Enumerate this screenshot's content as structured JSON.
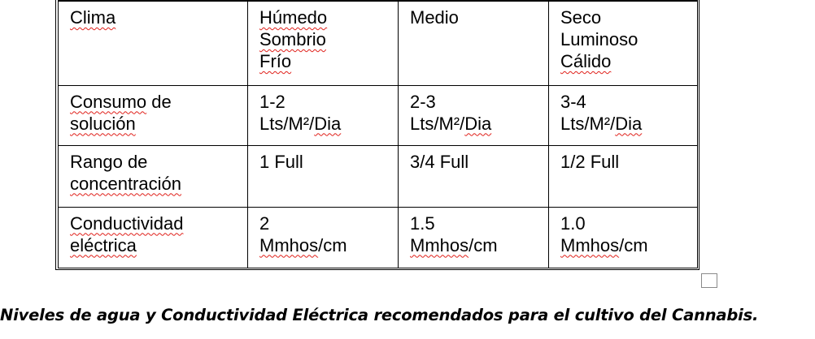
{
  "table": {
    "rows": [
      {
        "cells": [
          {
            "lines": [
              {
                "text": "Clima",
                "spell": true
              }
            ]
          },
          {
            "lines": [
              {
                "text": "Húmedo",
                "spell": true
              },
              {
                "text": "Sombrio",
                "spell": true
              },
              {
                "text": "Frío",
                "spell": true
              }
            ]
          },
          {
            "lines": [
              {
                "text": "Medio",
                "spell": false
              }
            ]
          },
          {
            "lines": [
              {
                "text": "Seco",
                "spell": false
              },
              {
                "text": "Luminoso",
                "spell": false
              },
              {
                "text": "Cálido",
                "spell": true
              }
            ]
          }
        ]
      },
      {
        "cells": [
          {
            "lines": [
              {
                "text": "Consumo de",
                "spell": "Consumo"
              },
              {
                "text": "solución",
                "spell": true
              }
            ]
          },
          {
            "lines": [
              {
                "text": "1-2",
                "spell": false
              },
              {
                "text": "Lts/M²/Dia",
                "spell": "Dia"
              }
            ]
          },
          {
            "lines": [
              {
                "text": "2-3",
                "spell": false
              },
              {
                "text": "Lts/M²/Dia",
                "spell": "Dia"
              }
            ]
          },
          {
            "lines": [
              {
                "text": "3-4",
                "spell": false
              },
              {
                "text": "Lts/M²/Dia",
                "spell": "Dia"
              }
            ]
          }
        ]
      },
      {
        "cells": [
          {
            "lines": [
              {
                "text": "Rango de",
                "spell": false
              },
              {
                "text": "concentración",
                "spell": true
              }
            ]
          },
          {
            "lines": [
              {
                "text": "1 Full",
                "spell": false
              }
            ]
          },
          {
            "lines": [
              {
                "text": "3/4 Full",
                "spell": false
              }
            ]
          },
          {
            "lines": [
              {
                "text": "1/2 Full",
                "spell": false
              }
            ]
          }
        ]
      },
      {
        "cells": [
          {
            "lines": [
              {
                "text": "Conductividad",
                "spell": true
              },
              {
                "text": "eléctrica",
                "spell": true
              }
            ]
          },
          {
            "lines": [
              {
                "text": "2",
                "spell": false
              },
              {
                "text": "Mmhos/cm",
                "spell": "Mmhos"
              }
            ]
          },
          {
            "lines": [
              {
                "text": "1.5",
                "spell": false
              },
              {
                "text": "Mmhos/cm",
                "spell": "Mmhos"
              }
            ]
          },
          {
            "lines": [
              {
                "text": "1.0",
                "spell": false
              },
              {
                "text": "Mmhos/cm",
                "spell": "Mmhos"
              }
            ]
          }
        ]
      }
    ]
  },
  "caption": "Niveles de agua y Conductividad Eléctrica recomendados para el cultivo del Cannabis.",
  "colors": {
    "text": "#000000",
    "spellcheck_underline": "#e0201a",
    "handle_border": "#8a8a8a"
  }
}
